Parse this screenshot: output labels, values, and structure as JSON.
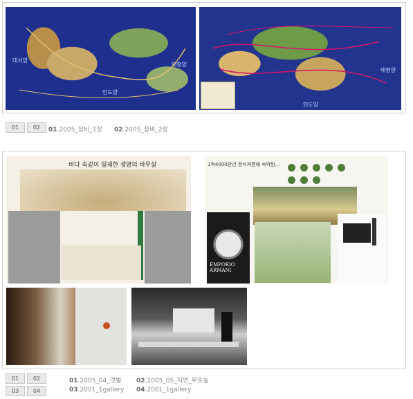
{
  "section1": {
    "buttons": [
      "01",
      "02"
    ],
    "captions": [
      {
        "num": "01",
        "text": ".2005_창비_1장"
      },
      {
        "num": "02",
        "text": ".2005_창비_2장"
      }
    ],
    "map1_labels": [
      "대서양",
      "인도양",
      "태평양"
    ],
    "map2_labels": [
      "태평양",
      "인도양"
    ]
  },
  "section2": {
    "buttons": [
      "01",
      "02",
      "03",
      "04"
    ],
    "captions": [
      {
        "num": "01",
        "text": ".2005_04_갯벌"
      },
      {
        "num": "02",
        "text": ".2005_05_지면_우포늪"
      },
      {
        "num": "03",
        "text": ".2001_1gallery"
      },
      {
        "num": "04",
        "text": ".2001_1gallery"
      }
    ],
    "spread1_heading": "바다 속같이 일궤한 생명의 바우살",
    "spread2_heading": "1억4000만년 한식저편에 숙막된...",
    "ad_brand": "EMPORIO ARMANI"
  }
}
